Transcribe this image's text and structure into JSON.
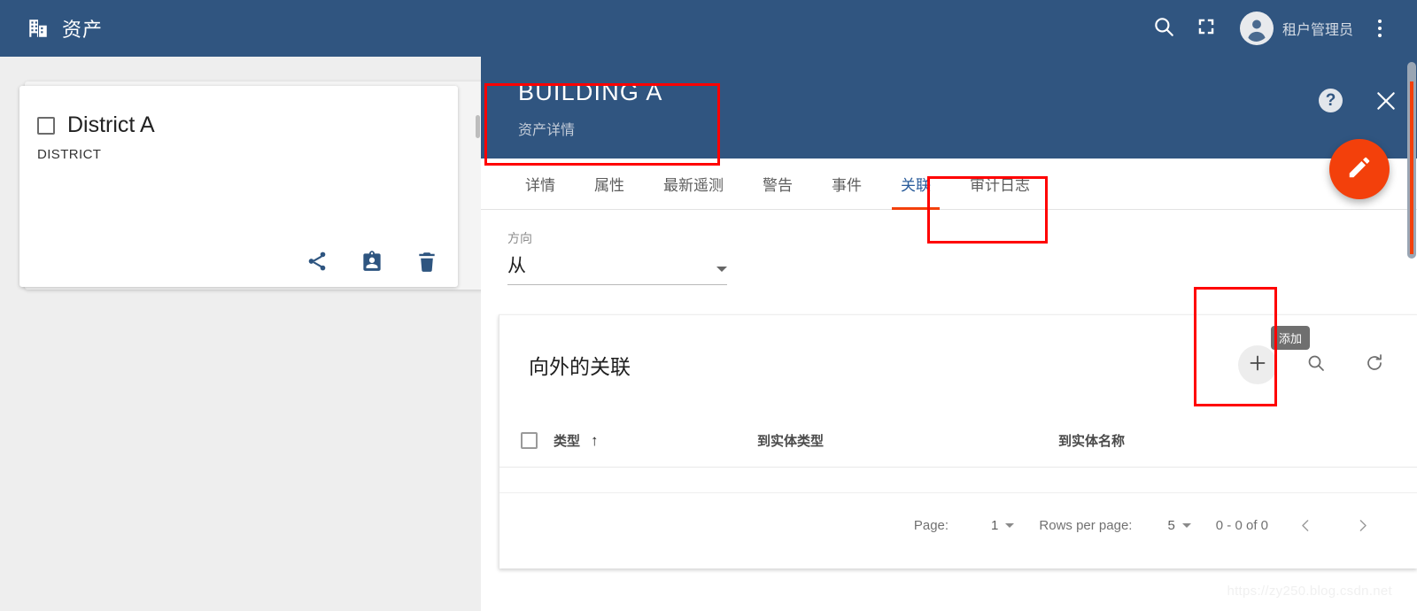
{
  "topbar": {
    "brand_icon": "building-icon",
    "title": "资产",
    "search_icon": "search-icon",
    "fullscreen_icon": "fullscreen-icon",
    "avatar_icon": "account-circle-icon",
    "user_name": "租户管理员",
    "more_icon": "more-vert-icon",
    "background_color": "#305580"
  },
  "left_pane": {
    "card": {
      "checkbox_checked": false,
      "title": "District A",
      "subtitle": "DISTRICT",
      "actions": [
        {
          "name": "share-icon",
          "label": "分享"
        },
        {
          "name": "assign-customer-icon",
          "label": "分配给客户"
        },
        {
          "name": "delete-icon",
          "label": "删除"
        }
      ]
    }
  },
  "detail": {
    "title": "BUILDING A",
    "subtitle": "资产详情",
    "help_icon": "help-icon",
    "close_icon": "close-icon",
    "edit_fab_icon": "pencil-icon",
    "accent_color": "#f3400b",
    "tabs": [
      {
        "label": "详情",
        "active": false
      },
      {
        "label": "属性",
        "active": false
      },
      {
        "label": "最新遥测",
        "active": false
      },
      {
        "label": "警告",
        "active": false
      },
      {
        "label": "事件",
        "active": false
      },
      {
        "label": "关联",
        "active": true
      },
      {
        "label": "审计日志",
        "active": false
      }
    ],
    "direction": {
      "label": "方向",
      "value": "从",
      "caret_icon": "chevron-down-icon"
    },
    "table": {
      "title": "向外的关联",
      "add_tooltip": "添加",
      "add_icon": "plus-icon",
      "search_icon": "search-icon",
      "refresh_icon": "refresh-icon",
      "columns": [
        {
          "label": "类型",
          "sort": "ascending",
          "sort_icon": "arrow-upward-icon"
        },
        {
          "label": "到实体类型",
          "sort": "none"
        },
        {
          "label": "到实体名称",
          "sort": "none"
        }
      ],
      "rows": [],
      "footer": {
        "page_label": "Page:",
        "page_value": "1",
        "rows_per_page_label": "Rows per page:",
        "rows_per_page_value": "5",
        "range": "0 - 0 of 0",
        "prev_icon": "chevron-left-icon",
        "next_icon": "chevron-right-icon"
      }
    }
  },
  "watermark": "https://zy250.blog.csdn.net"
}
